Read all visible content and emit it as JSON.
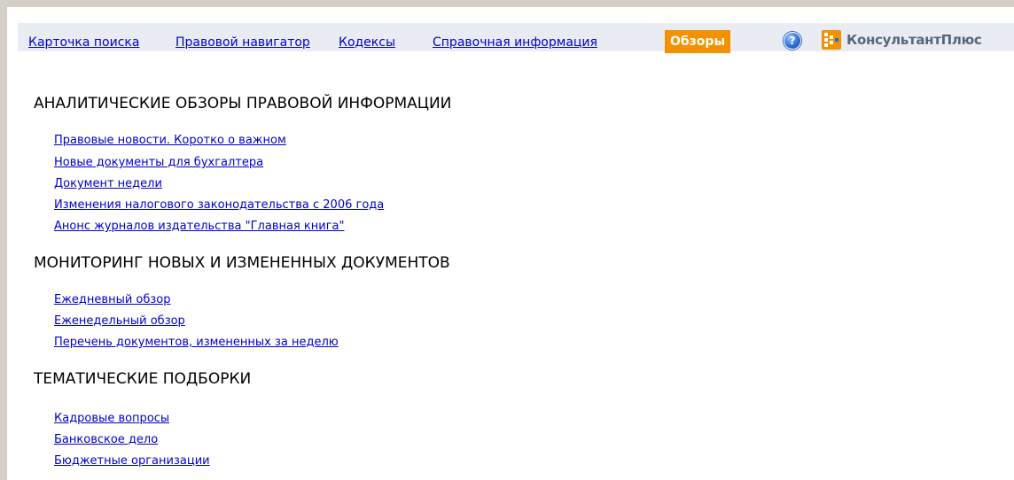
{
  "toolbar": {
    "nav": [
      {
        "label": "Карточка поиска"
      },
      {
        "label": "Правовой навигатор"
      },
      {
        "label": "Кодексы"
      },
      {
        "label": "Справочная информация"
      }
    ],
    "active": {
      "label": "Обзоры"
    },
    "help_icon": "help-icon",
    "brand": {
      "text": "КонсультантПлюс",
      "logo_icon": "consultant-plus-logo"
    },
    "colors": {
      "active_bg": "#f39200",
      "strip_bg": "#e9edf3",
      "link": "#0000cc"
    }
  },
  "sections": [
    {
      "title": "АНАЛИТИЧЕСКИЕ ОБЗОРЫ ПРАВОВОЙ ИНФОРМАЦИИ",
      "links": [
        "Правовые новости. Коротко о важном",
        "Новые документы для бухгалтера",
        "Документ недели",
        "Изменения налогового законодательства с 2006 года",
        "Анонс журналов издательства \"Главная книга\""
      ]
    },
    {
      "title": "МОНИТОРИНГ НОВЫХ И ИЗМЕНЕННЫХ ДОКУМЕНТОВ",
      "links": [
        "Ежедневный обзор",
        "Еженедельный обзор",
        "Перечень документов, измененных за неделю"
      ]
    },
    {
      "title": "ТЕМАТИЧЕСКИЕ ПОДБОРКИ",
      "links": [
        "Кадровые вопросы",
        "Банковское дело",
        "Бюджетные организации"
      ]
    }
  ]
}
